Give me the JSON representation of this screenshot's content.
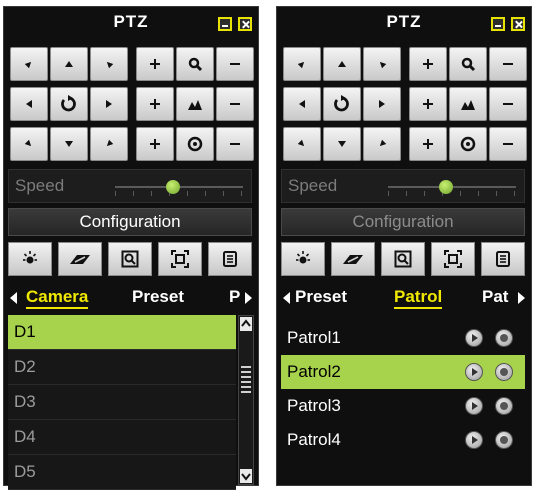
{
  "colors": {
    "accent_yellow": "#f0e800",
    "selected_green": "#a7d24c",
    "panel_bg": "#0f0f0f"
  },
  "panels": [
    {
      "title": "PTZ",
      "speed_label": "Speed",
      "speed_level": 0.45,
      "config_label": "Configuration",
      "config_enabled": true,
      "tabs": {
        "left": "Camera",
        "middle": "Preset",
        "right": "P"
      },
      "camera_items": [
        "D1",
        "D2",
        "D3",
        "D4",
        "D5"
      ]
    },
    {
      "title": "PTZ",
      "speed_label": "Speed",
      "speed_level": 0.45,
      "config_label": "Configuration",
      "config_enabled": false,
      "tabs": {
        "left": "Preset",
        "middle": "Patrol",
        "right": "Pat"
      },
      "patrol_items": [
        "Patrol1",
        "Patrol2",
        "Patrol3",
        "Patrol4"
      ]
    }
  ],
  "icons": {
    "window": [
      "minimize-icon",
      "close-icon"
    ],
    "tools": [
      "light-icon",
      "wiper-icon",
      "zoom-area-icon",
      "center-icon",
      "menu-icon"
    ]
  }
}
